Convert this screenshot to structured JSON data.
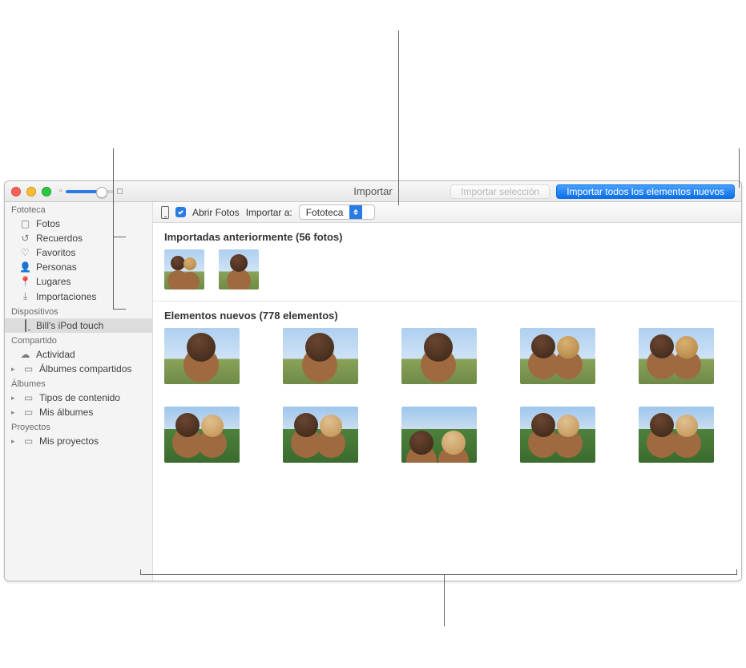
{
  "window_title": "Importar",
  "toolbar": {
    "import_selection": "Importar selección",
    "import_all_new": "Importar todos los elementos nuevos"
  },
  "import_bar": {
    "open_photos_label": "Abrir Fotos",
    "import_to_label": "Importar a:",
    "import_to_value": "Fototeca"
  },
  "sidebar": {
    "sections": [
      {
        "header": "Fototeca",
        "items": [
          {
            "label": "Fotos",
            "icon": "photo"
          },
          {
            "label": "Recuerdos",
            "icon": "clock"
          },
          {
            "label": "Favoritos",
            "icon": "heart"
          },
          {
            "label": "Personas",
            "icon": "person"
          },
          {
            "label": "Lugares",
            "icon": "pin"
          },
          {
            "label": "Importaciones",
            "icon": "download"
          }
        ]
      },
      {
        "header": "Dispositivos",
        "items": [
          {
            "label": "Bill's iPod touch",
            "icon": "device",
            "selected": true
          }
        ]
      },
      {
        "header": "Compartido",
        "items": [
          {
            "label": "Actividad",
            "icon": "cloud"
          },
          {
            "label": "Álbumes compartidos",
            "icon": "album",
            "disclosure": true
          }
        ]
      },
      {
        "header": "Álbumes",
        "items": [
          {
            "label": "Tipos de contenido",
            "icon": "album",
            "disclosure": true
          },
          {
            "label": "Mis álbumes",
            "icon": "album",
            "disclosure": true
          }
        ]
      },
      {
        "header": "Proyectos",
        "items": [
          {
            "label": "Mis proyectos",
            "icon": "album",
            "disclosure": true
          }
        ]
      }
    ]
  },
  "sections": {
    "previously_imported_title": "Importadas anteriormente (56 fotos)",
    "new_items_title": "Elementos nuevos (778 elementos)"
  }
}
